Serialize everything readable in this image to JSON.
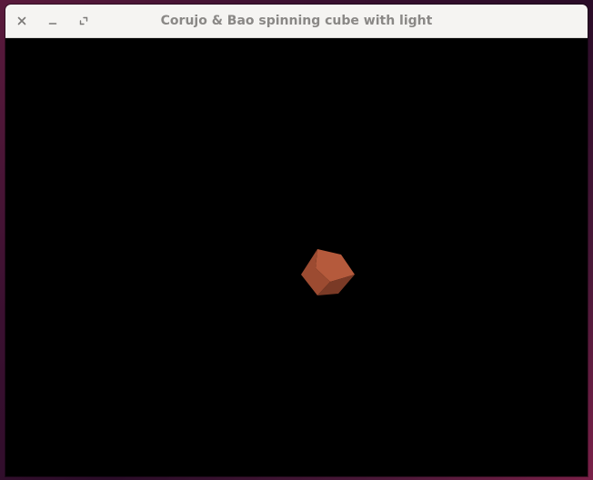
{
  "window": {
    "title": "Corujo & Bao spinning cube with light",
    "buttons": {
      "close_icon": "close-icon",
      "minimize_icon": "minimize-icon",
      "maximize_icon": "maximize-icon"
    }
  },
  "scene": {
    "background_color": "#000000",
    "cube": {
      "top_face_color": "#b55a3c",
      "left_face_color": "#9c4b31",
      "right_face_color": "#7a3a26"
    }
  }
}
